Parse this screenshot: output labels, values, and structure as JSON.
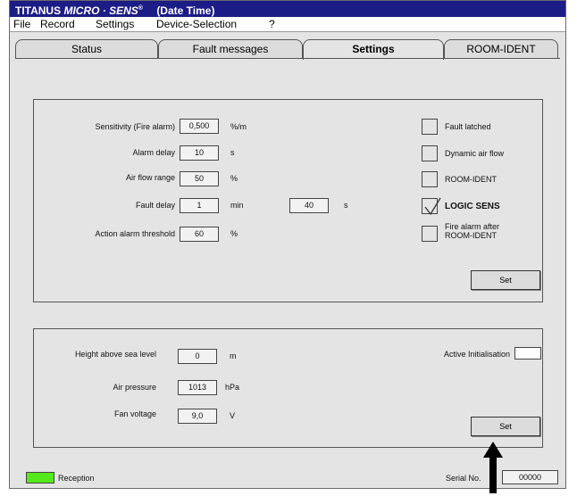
{
  "window": {
    "title_prefix": "TITANUS",
    "title_brand": "MICRO · SENS",
    "title_reg": "®",
    "title_suffix": "(Date Time)"
  },
  "menu": [
    "File",
    "Record",
    "Settings",
    "Device-Selection",
    "?"
  ],
  "tabs": [
    "Status",
    "Fault messages",
    "Settings",
    "ROOM-IDENT"
  ],
  "active_tab": "Settings",
  "detector": {
    "sensitivity": {
      "label": "Sensitivity (Fire alarm)",
      "value": "0,500",
      "unit": "%/m"
    },
    "alarm_delay": {
      "label": "Alarm delay",
      "value": "10",
      "unit": "s"
    },
    "air_flow_range": {
      "label": "Air flow range",
      "value": "50",
      "unit": "%"
    },
    "fault_delay": {
      "label": "Fault delay",
      "value_min": "1",
      "unit_min": "min",
      "value_s": "40",
      "unit_s": "s"
    },
    "action_alarm": {
      "label": "Action alarm threshold",
      "value": "60",
      "unit": "%"
    },
    "checkboxes": [
      {
        "label": "Fault latched",
        "checked": false
      },
      {
        "label": "Dynamic air flow",
        "checked": false
      },
      {
        "label": "ROOM-IDENT",
        "checked": false
      },
      {
        "label": "LOGIC SENS",
        "checked": true
      },
      {
        "label_line1": "Fire alarm after",
        "label_line2": "ROOM-IDENT",
        "checked": false
      }
    ],
    "set_label": "Set"
  },
  "environment": {
    "height": {
      "label": "Height above sea level",
      "value": "0",
      "unit": "m"
    },
    "pressure": {
      "label": "Air pressure",
      "value": "1013",
      "unit": "hPa"
    },
    "fan_voltage": {
      "label": "Fan voltage",
      "value": "9,0",
      "unit": "V"
    },
    "active_init_label": "Active Initialisation",
    "set_label": "Set"
  },
  "status": {
    "reception_label": "Reception",
    "reception_color": "#55e81c",
    "serial_label": "Serial No.",
    "serial_value": "00000"
  }
}
